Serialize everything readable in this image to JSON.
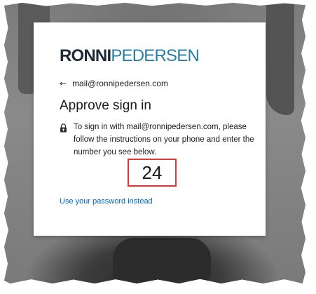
{
  "brand": {
    "logo_bold": "RONNI",
    "logo_light": "PEDERSEN",
    "logo_bold_color": "#1f2a38",
    "logo_light_color": "#2a7fa6"
  },
  "identity": {
    "back_icon": "back-arrow-icon",
    "email": "mail@ronnipedersen.com"
  },
  "page": {
    "title": "Approve sign in",
    "info_icon": "lock-icon",
    "instructions": "To sign in with mail@ronnipedersen.com, please follow the instructions on your phone and enter the number you see below.",
    "number": "24",
    "highlight_color": "#d9383a"
  },
  "links": {
    "use_password": "Use your password instead",
    "link_color": "#0067b8"
  }
}
